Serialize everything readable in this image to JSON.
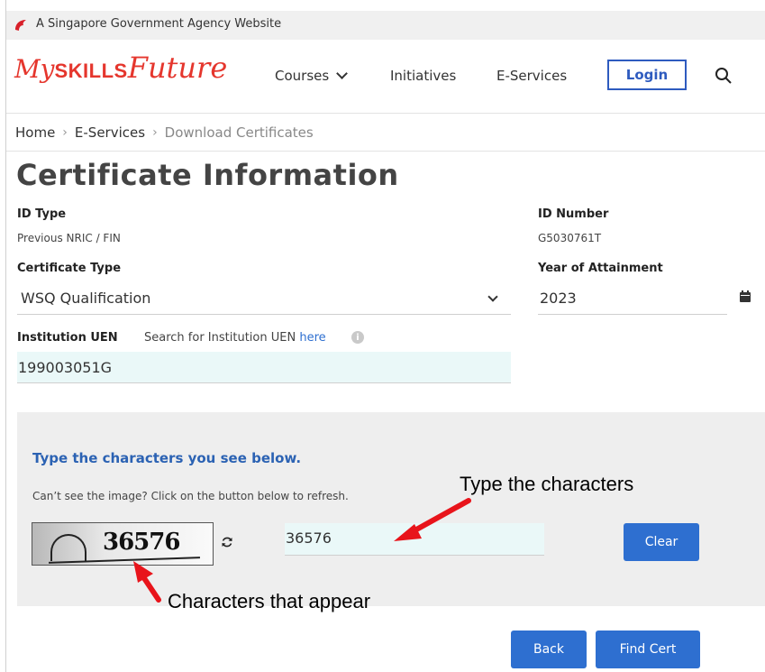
{
  "gov_banner": {
    "text": "A Singapore Government Agency Website",
    "icon": "lion-head-icon"
  },
  "header": {
    "logo": {
      "my": "My",
      "skills": "SKILLS",
      "future": "Future"
    },
    "nav": {
      "courses": "Courses",
      "initiatives": "Initiatives",
      "eservices": "E-Services"
    },
    "login_label": "Login",
    "search_icon": "search-icon"
  },
  "breadcrumb": {
    "home": "Home",
    "eservices": "E-Services",
    "current": "Download Certificates"
  },
  "page_title": "Certificate Information",
  "form": {
    "id_type": {
      "label": "ID Type",
      "value": "Previous NRIC / FIN"
    },
    "id_number": {
      "label": "ID Number",
      "value": "G5030761T"
    },
    "certificate_type": {
      "label": "Certificate Type",
      "value": "WSQ Qualification"
    },
    "year": {
      "label": "Year of Attainment",
      "value": "2023"
    },
    "uen": {
      "label": "Institution UEN",
      "help_prefix": "Search for Institution UEN",
      "help_link": "here",
      "info": "i",
      "value": "199003051G"
    }
  },
  "captcha": {
    "title": "Type the characters you see below.",
    "help": "Can’t see the image? Click on the button below to refresh.",
    "image_text": "36576",
    "input_value": "36576",
    "clear_label": "Clear"
  },
  "annotations": {
    "type_chars": "Type the characters",
    "chars_appear": "Characters that appear",
    "arrow_color": "#e8141b"
  },
  "actions": {
    "back_label": "Back",
    "find_label": "Find Cert"
  },
  "colors": {
    "brand_red": "#e5362d",
    "primary_blue": "#2e6fd0",
    "input_bg": "#eaf8f8",
    "panel_bg": "#eeeeee"
  }
}
